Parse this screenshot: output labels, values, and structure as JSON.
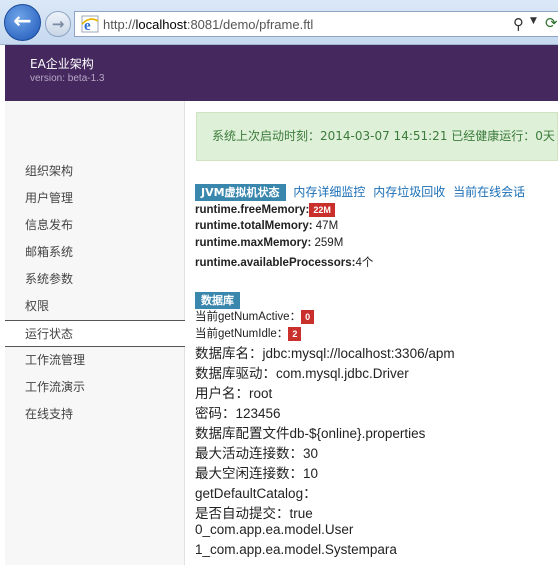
{
  "browser": {
    "back_icon": "back-arrow-icon",
    "forward_icon": "forward-arrow-icon",
    "url_prefix": "http://",
    "url_host": "localhost",
    "url_rest": ":8081/demo/pframe.ftl"
  },
  "header": {
    "title": "EA企业架构",
    "version": "version: beta-1.3"
  },
  "sidebar": {
    "items": [
      {
        "label": "组织架构"
      },
      {
        "label": "用户管理"
      },
      {
        "label": "信息发布"
      },
      {
        "label": "邮箱系统"
      },
      {
        "label": "系统参数"
      },
      {
        "label": "权限"
      },
      {
        "label": "运行状态",
        "active": true
      },
      {
        "label": "工作流管理"
      },
      {
        "label": "工作流演示"
      },
      {
        "label": "在线支持"
      }
    ]
  },
  "alert": {
    "text": "系统上次启动时刻：2014-03-07 14:51:21 已经健康运行：0天"
  },
  "jvm": {
    "label": "JVM虚拟机状态",
    "links": [
      "内存详细监控",
      "内存垃圾回收",
      "当前在线会话"
    ],
    "free_key": "runtime.freeMemory:",
    "free_val": "22M",
    "total_key": "runtime.totalMemory:",
    "total_val": " 47M",
    "max_key": "runtime.maxMemory:",
    "max_val": " 259M",
    "proc_key": "runtime.availableProcessors:",
    "proc_val": "4个"
  },
  "db": {
    "label": "数据库",
    "active_key": "当前getNumActive：",
    "active_val": "0",
    "idle_key": "当前getNumIdle：",
    "idle_val": "2",
    "lines": [
      "数据库名：jdbc:mysql://localhost:3306/apm",
      "数据库驱动：com.mysql.jdbc.Driver",
      "用户名：root",
      "密码：123456",
      "数据库配置文件db-${online}.properties",
      "最大活动连接数：30",
      "最大空闲连接数：10",
      "getDefaultCatalog：",
      "是否自动提交：true",
      "0_com.app.ea.model.User",
      "1_com.app.ea.model.Systempara"
    ]
  }
}
